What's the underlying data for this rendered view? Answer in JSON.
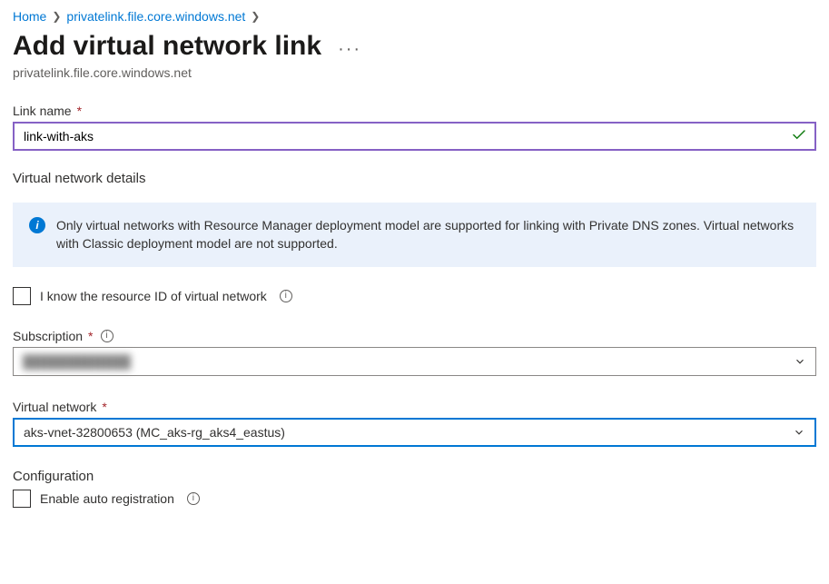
{
  "breadcrumb": {
    "home": "Home",
    "zone": "privatelink.file.core.windows.net"
  },
  "page": {
    "title": "Add virtual network link",
    "subtitle": "privatelink.file.core.windows.net"
  },
  "linkName": {
    "label": "Link name",
    "value": "link-with-aks"
  },
  "vnetDetails": {
    "heading": "Virtual network details",
    "banner": "Only virtual networks with Resource Manager deployment model are supported for linking with Private DNS zones. Virtual networks with Classic deployment model are not supported."
  },
  "knowResourceId": {
    "label": "I know the resource ID of virtual network"
  },
  "subscription": {
    "label": "Subscription",
    "value": "████████████"
  },
  "vnet": {
    "label": "Virtual network",
    "value": "aks-vnet-32800653 (MC_aks-rg_aks4_eastus)"
  },
  "config": {
    "heading": "Configuration",
    "autoReg": "Enable auto registration"
  }
}
